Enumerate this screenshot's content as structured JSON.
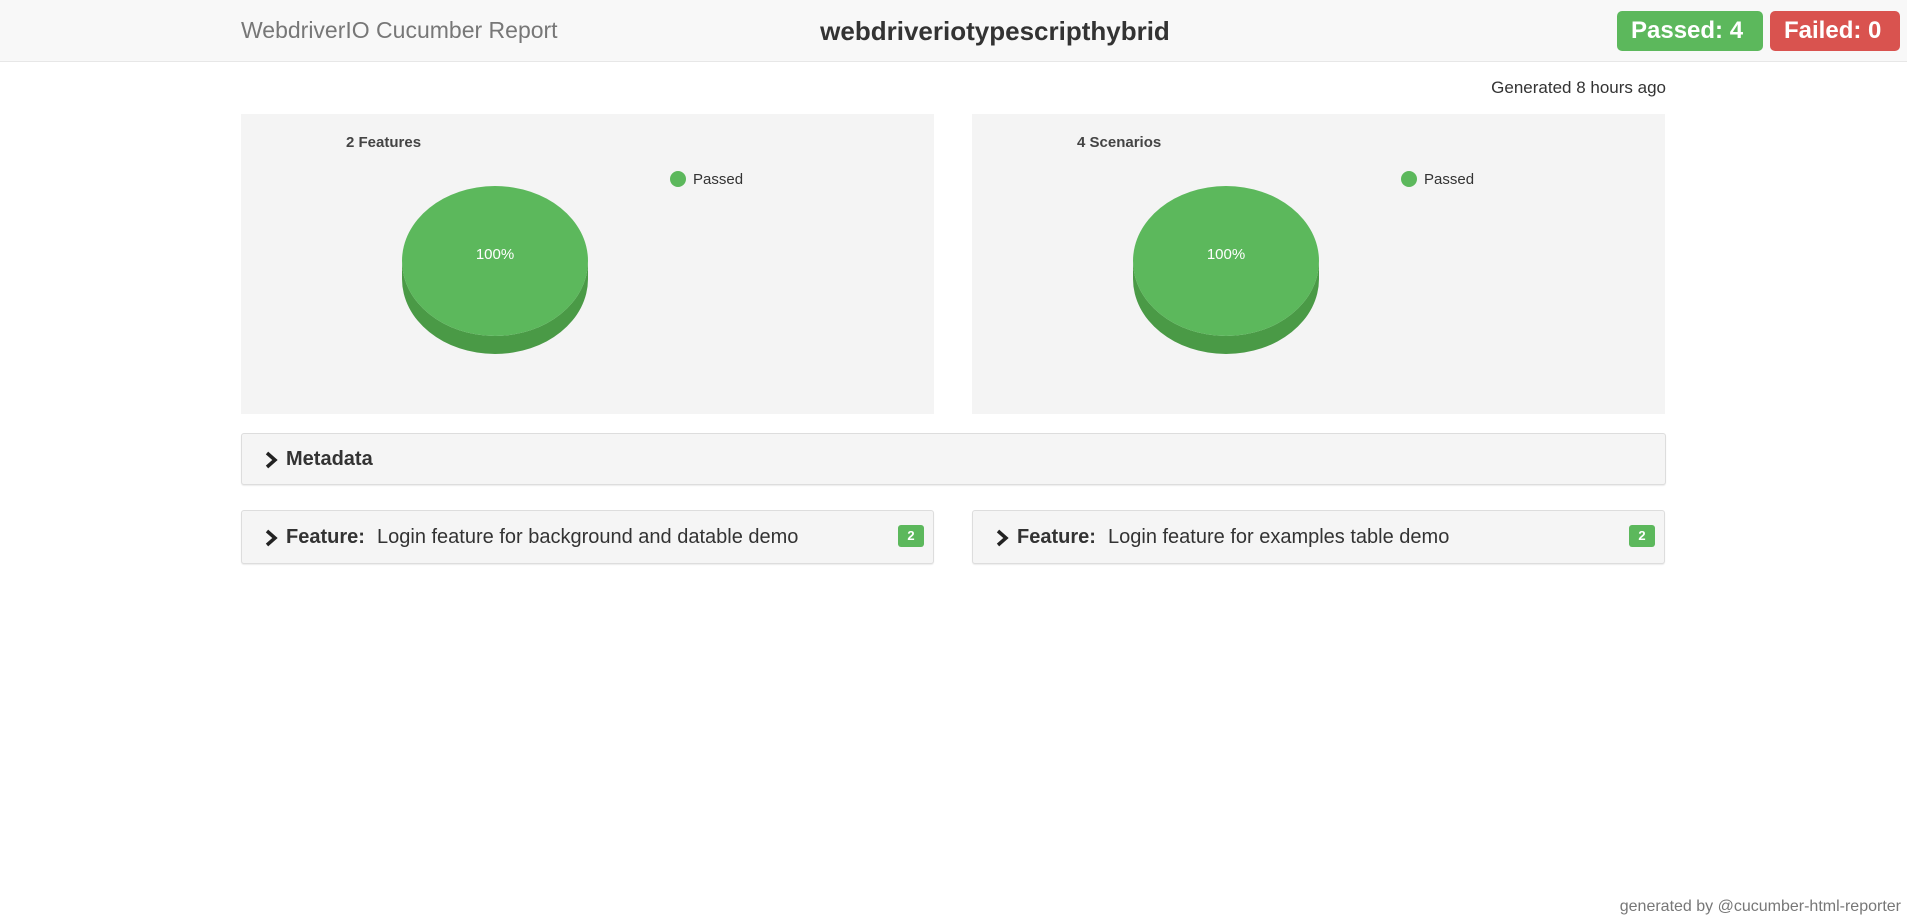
{
  "header": {
    "brand": "WebdriverIO Cucumber Report",
    "project": "webdriveriotypescripthybrid",
    "passed_label": "Passed: 4",
    "failed_label": "Failed: 0"
  },
  "generated": "Generated 8 hours ago",
  "colors": {
    "passed": "#5cb85c",
    "passed_dark": "#4a9a46",
    "failed": "#d9534f"
  },
  "chart_data": [
    {
      "type": "pie",
      "title": "2 Features",
      "categories": [
        "Passed"
      ],
      "values": [
        100
      ],
      "data_labels": [
        "100%"
      ],
      "legend": "top-right"
    },
    {
      "type": "pie",
      "title": "4 Scenarios",
      "categories": [
        "Passed"
      ],
      "values": [
        100
      ],
      "data_labels": [
        "100%"
      ],
      "legend": "top-right"
    }
  ],
  "metadata": {
    "title": "Metadata"
  },
  "features": [
    {
      "keyword": "Feature:",
      "name": "Login feature for background and datable demo",
      "count": "2"
    },
    {
      "keyword": "Feature:",
      "name": "Login feature for examples table demo",
      "count": "2"
    }
  ],
  "footer": "generated by @cucumber-html-reporter"
}
